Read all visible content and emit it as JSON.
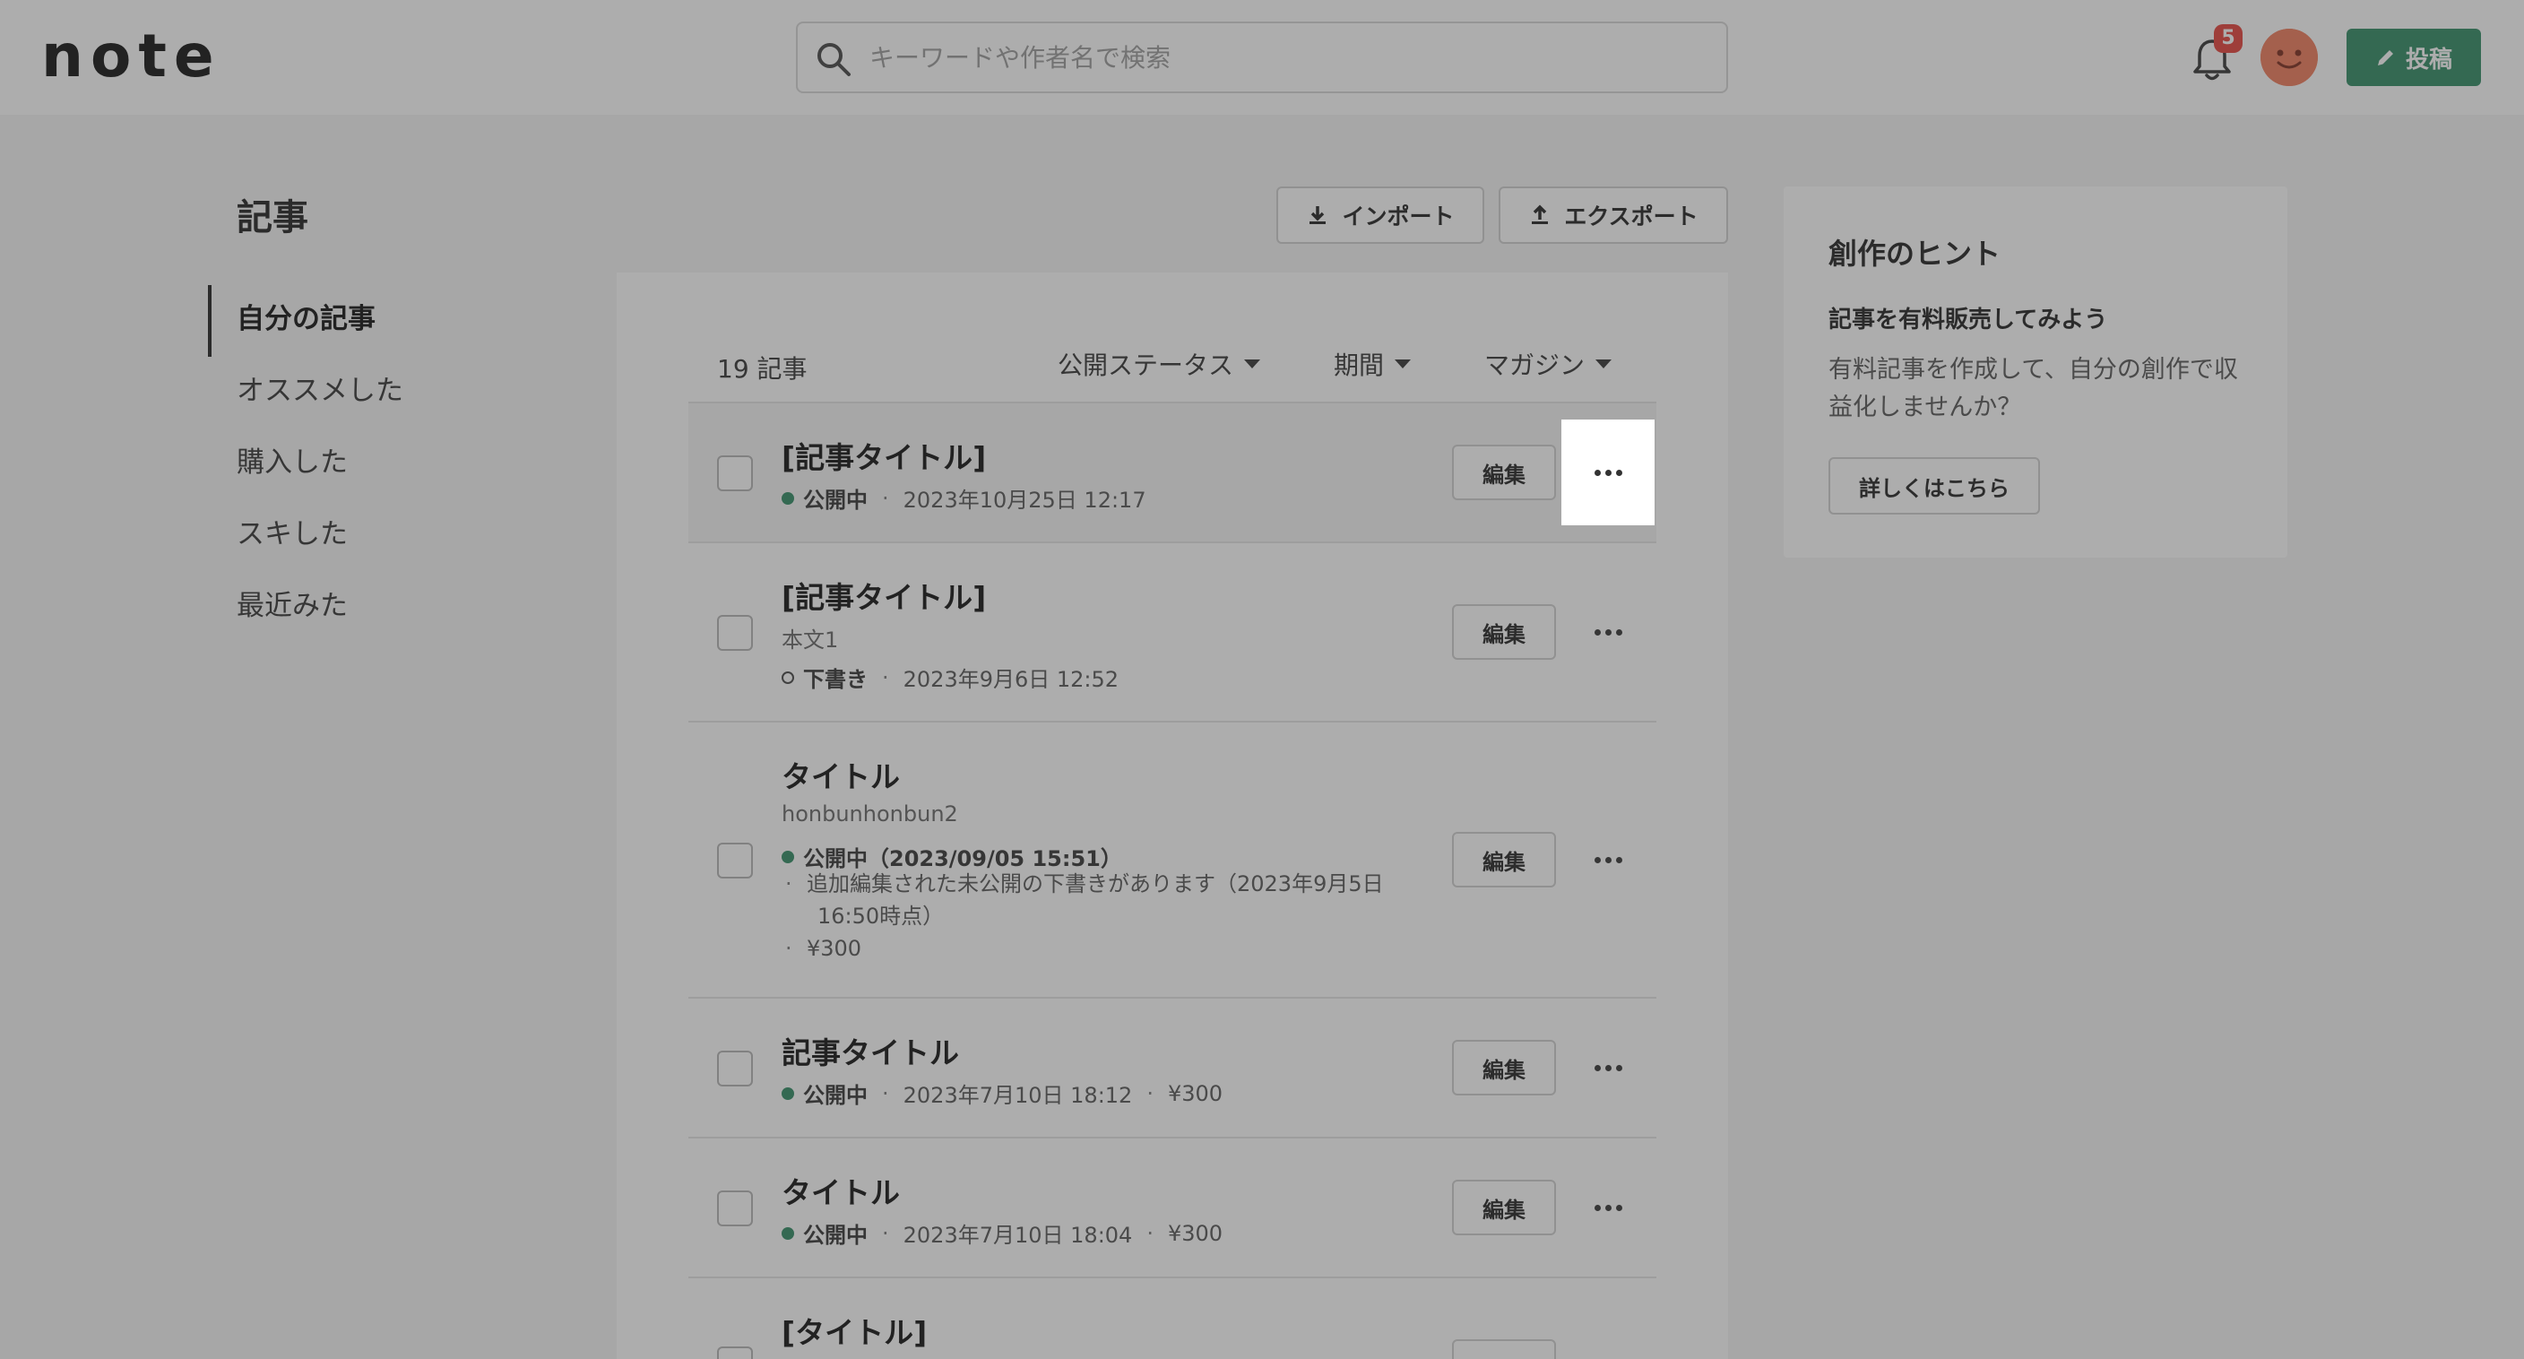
{
  "header": {
    "logo": "note",
    "search_placeholder": "キーワードや作者名で検索",
    "notification_count": "5",
    "post_label": "投稿"
  },
  "sidebar": {
    "title": "記事",
    "items": [
      {
        "label": "自分の記事"
      },
      {
        "label": "オススメした"
      },
      {
        "label": "購入した"
      },
      {
        "label": "スキした"
      },
      {
        "label": "最近みた"
      }
    ]
  },
  "toolbar": {
    "import_label": "インポート",
    "export_label": "エクスポート"
  },
  "list": {
    "count": "19 記事",
    "filters": [
      "公開ステータス",
      "期間",
      "マガジン"
    ],
    "edit_label": "編集",
    "rows": [
      {
        "title": "[記事タイトル]",
        "status": "公開中",
        "date": "2023年10月25日 12:17"
      },
      {
        "title": "[記事タイトル]",
        "body": "本文1",
        "status": "下書き",
        "date": "2023年9月6日 12:52"
      },
      {
        "title": "タイトル",
        "body": "honbunhonbun2",
        "status": "公開中（2023/09/05 15:51）",
        "note_1": "追加編集された未公開の下書きがあります（2023年9月5日",
        "note_1b": "16:50時点）",
        "note_2": "¥300"
      },
      {
        "title": "記事タイトル",
        "status": "公開中",
        "date": "2023年7月10日 18:12",
        "price": "¥300"
      },
      {
        "title": "タイトル",
        "status": "公開中",
        "date": "2023年7月10日 18:04",
        "price": "¥300"
      },
      {
        "title": "[タイトル]"
      }
    ]
  },
  "hint": {
    "title": "創作のヒント",
    "subtitle": "記事を有料販売してみよう",
    "text": "有料記事を作成して、自分の創作で収益化しませんか？",
    "button": "詳しくはこちら"
  },
  "colors": {
    "accent": "#2f8a63",
    "badge": "#e5413a",
    "avatar": "#f07a5a"
  }
}
